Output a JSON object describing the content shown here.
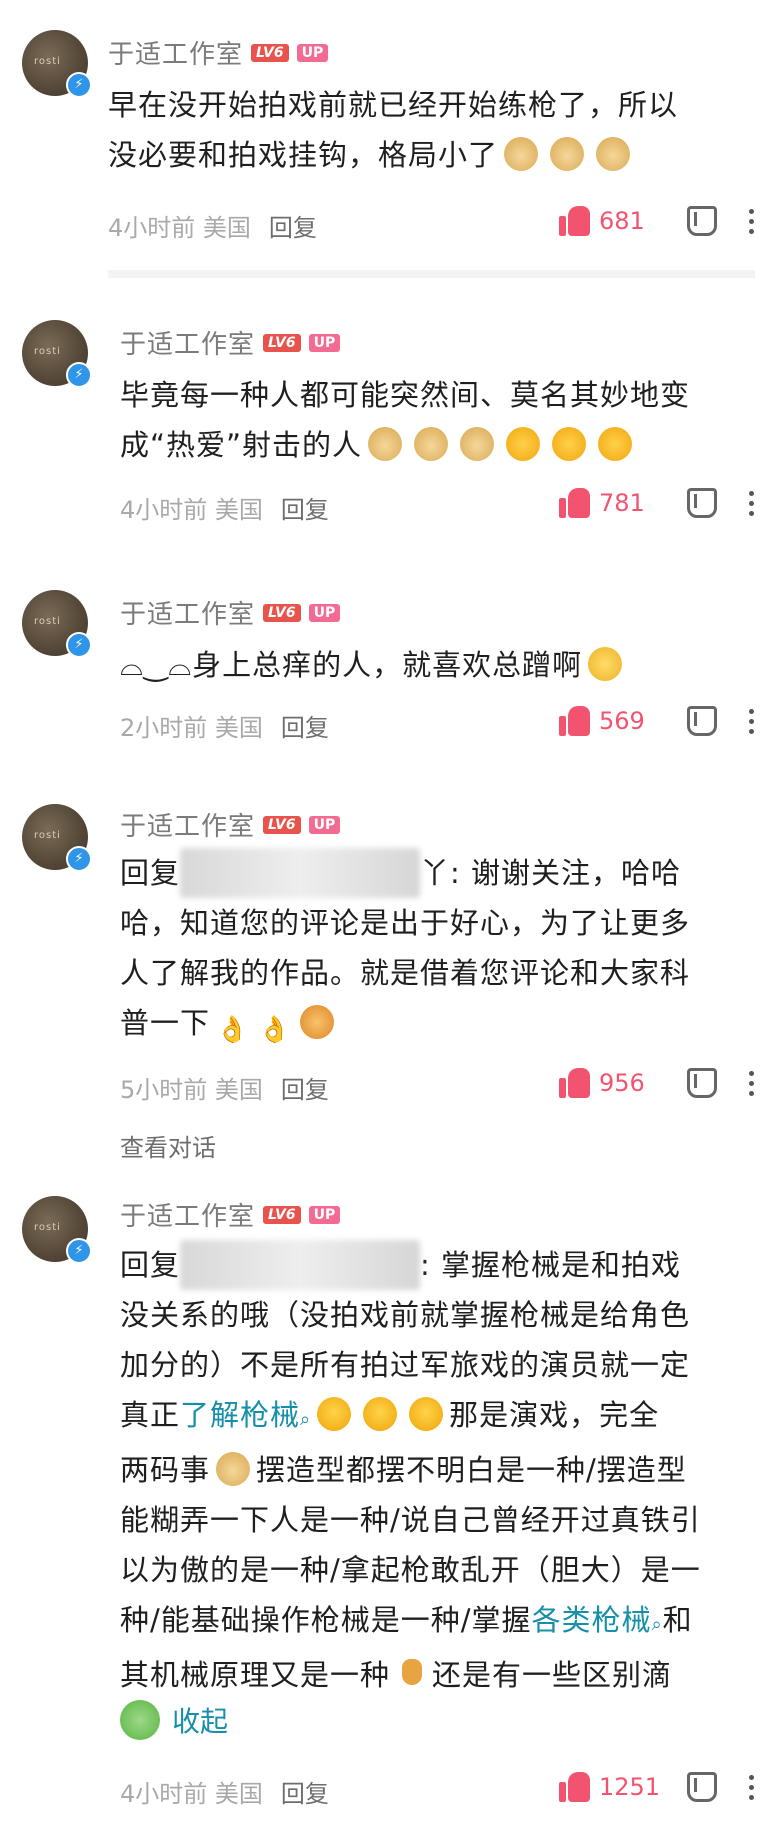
{
  "author": {
    "name": "于适工作室",
    "level": "LV6",
    "badge": "UP"
  },
  "reply_label": "回复",
  "comments": [
    {
      "lines": [
        "早在没开始拍戏前就已经开始练枪了，所以",
        "没必要和拍戏挂钩，格局小了"
      ],
      "time": "4小时前",
      "location": "美国",
      "likes": "681"
    },
    {
      "lines": [
        "毕竟每一种人都可能突然间、莫名其妙地变",
        "成“热爱”射击的人"
      ],
      "time": "4小时前",
      "location": "美国",
      "likes": "781"
    },
    {
      "lines": [
        "⌓‿⌓身上总痒的人，就喜欢总蹭啊"
      ],
      "time": "2小时前",
      "location": "美国",
      "likes": "569"
    },
    {
      "reply_prefix": "回复",
      "reply_suffix": "丫: 谢谢关注，哈哈",
      "lines": [
        "哈，知道您的评论是出于好心，为了让更多",
        "人了解我的作品。就是借着您评论和大家科",
        "普一下"
      ],
      "time": "5小时前",
      "location": "美国",
      "likes": "956",
      "view_conversation": "查看对话"
    },
    {
      "reply_prefix": "回复",
      "reply_suffix": ": 掌握枪械是和拍戏",
      "lines": [
        "没关系的哦（没拍戏前就掌握枪械是给角色",
        "加分的）不是所有拍过军旅戏的演员就一定",
        "真正",
        "了解枪械",
        "那是演戏，完全",
        "两码事",
        "摆造型都摆不明白是一种/摆造型",
        "能糊弄一下人是一种/说自己曾经开过真铁引",
        "以为傲的是一种/拿起枪敢乱开（胆大）是一",
        "种/能基础操作枪械是一种/掌握",
        "各类枪械",
        "和",
        "其机械原理又是一种",
        "还是有一些区别滴"
      ],
      "collapse_label": "收起",
      "time": "4小时前",
      "location": "美国",
      "likes": "1251"
    }
  ]
}
